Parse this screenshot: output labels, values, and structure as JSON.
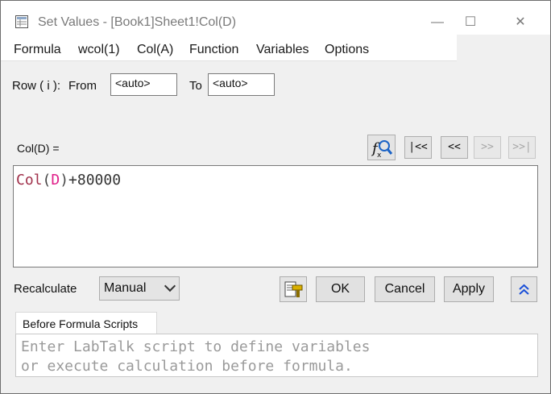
{
  "window": {
    "title": "Set Values - [Book1]Sheet1!Col(D)",
    "minimize_glyph": "—",
    "maximize_glyph": "☐",
    "close_glyph": "✕"
  },
  "menu": [
    "Formula",
    "wcol(1)",
    "Col(A)",
    "Function",
    "Variables",
    "Options"
  ],
  "row_range": {
    "row_label": "Row ( i ):",
    "from_label": "From",
    "from_value": "<auto>",
    "to_label": "To",
    "to_value": "<auto>"
  },
  "formula_section": {
    "col_label": "Col(D) =",
    "nav": [
      "|<<",
      "<<",
      ">>",
      ">>|"
    ],
    "formula_tokens": {
      "func": "Col",
      "open": "(",
      "arg": "D",
      "close": ")",
      "rest": "+80000"
    }
  },
  "recalculate": {
    "label": "Recalculate",
    "mode": "Manual"
  },
  "buttons": {
    "ok": "OK",
    "cancel": "Cancel",
    "apply": "Apply"
  },
  "before_scripts": {
    "tab_label": "Before Formula Scripts",
    "placeholder_line1": "Enter LabTalk script to define variables",
    "placeholder_line2": "or execute calculation before formula."
  },
  "icons": {
    "app": "set-values-app-icon",
    "fx_search": "fx-search-icon",
    "script_tool": "script-tool-icon",
    "collapse": "double-chevron-up-icon"
  },
  "colors": {
    "keyword": "#a0304a",
    "argument": "#e0208a",
    "collapse_arrow": "#1a4fd8"
  }
}
